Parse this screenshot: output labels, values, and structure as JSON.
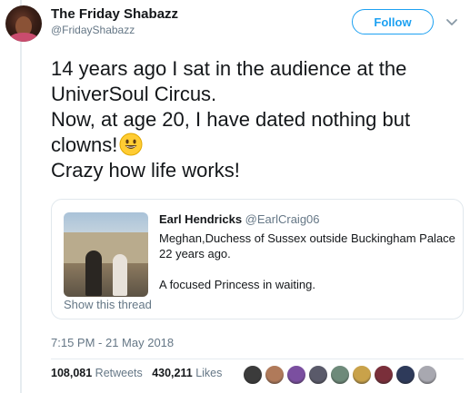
{
  "author": {
    "display_name": "The Friday Shabazz",
    "handle": "@FridayShabazz"
  },
  "follow_label": "Follow",
  "tweet_lines": [
    "14 years ago I sat in the audience at the",
    "UniverSoul Circus.",
    "Now, at age 20, I have dated nothing but",
    "clowns!",
    "Crazy how life works!"
  ],
  "quote": {
    "author_name": "Earl Hendricks",
    "author_handle": "@EarlCraig06",
    "lines": [
      "Meghan,Duchess of Sussex outside Buckingham Palace",
      "22 years ago.",
      "",
      "A focused Princess in waiting."
    ],
    "show_thread": "Show this thread"
  },
  "timestamp": "7:15 PM - 21 May 2018",
  "stats": {
    "retweets_count": "108,081",
    "retweets_label": "Retweets",
    "likes_count": "430,211",
    "likes_label": "Likes"
  },
  "colors": {
    "accent": "#1da1f2",
    "secondary_text": "#657786"
  },
  "icons": {
    "caret": "chevron-down-icon",
    "emoji": "grinning-face-emoji-icon"
  },
  "liker_avatar_colors": [
    "#3b3b3b",
    "#b07a5a",
    "#7b4fa0",
    "#5a5a6a",
    "#6e8a7a",
    "#c9a24a",
    "#7a2f3a",
    "#2e3a5a",
    "#a8a8b0"
  ]
}
